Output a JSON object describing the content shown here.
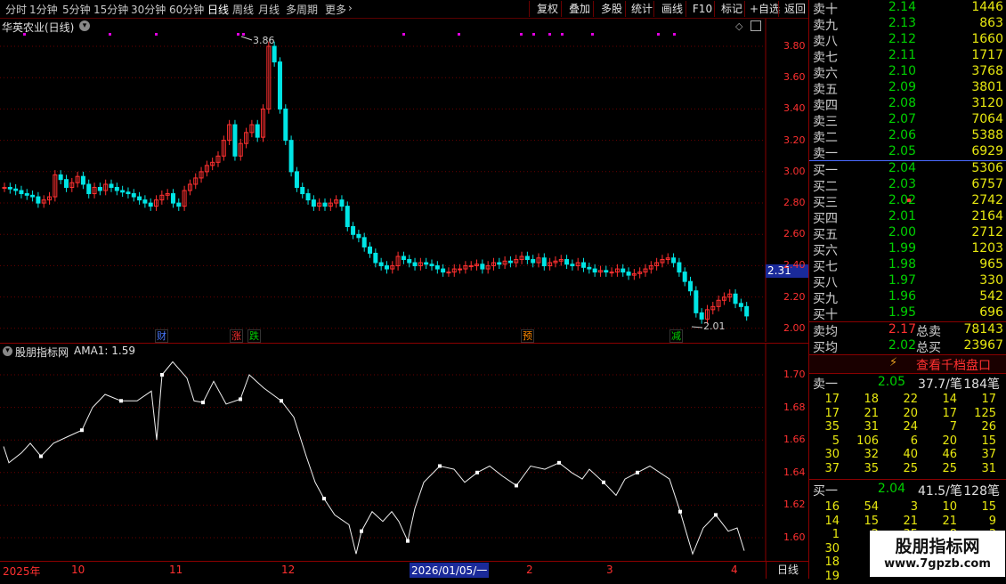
{
  "toolbar": {
    "periods": [
      "分时",
      "1分钟",
      "5分钟",
      "15分钟",
      "30分钟",
      "60分钟",
      "日线",
      "周线",
      "月线",
      "多周期",
      "更多"
    ],
    "more_arrow": "›",
    "buttons": [
      "复权",
      "叠加",
      "多股",
      "统计",
      "画线",
      "F10",
      "标记",
      "+自选",
      "返回"
    ]
  },
  "main": {
    "title": "华英农业(日线)",
    "price_ticks": [
      "3.80",
      "3.60",
      "3.40",
      "3.20",
      "3.00",
      "2.80",
      "2.60",
      "2.40",
      "2.20",
      "2.00"
    ],
    "current_price": "2.31",
    "high_label": "3.86",
    "low_label": "2.01",
    "event_tags": [
      {
        "text": "财",
        "color": "#4a7aff"
      },
      {
        "text": "涨",
        "color": "#ff3030"
      },
      {
        "text": "跌",
        "color": "#00d000"
      },
      {
        "text": "预",
        "color": "#ff8800"
      },
      {
        "text": "减",
        "color": "#00d000"
      }
    ]
  },
  "indicator": {
    "title": "股朋指标网",
    "ama_label": "AMA1: 1.59",
    "ticks": [
      "1.70",
      "1.68",
      "1.66",
      "1.64",
      "1.62",
      "1.60"
    ]
  },
  "date_axis": {
    "labels": [
      "2025年",
      "10",
      "11",
      "12",
      "2026/01/05/一",
      "2",
      "3",
      "4"
    ],
    "period": "日线"
  },
  "orderbook": {
    "asks": [
      {
        "label": "卖十",
        "price": "2.14",
        "vol": "1446"
      },
      {
        "label": "卖九",
        "price": "2.13",
        "vol": "863"
      },
      {
        "label": "卖八",
        "price": "2.12",
        "vol": "1660"
      },
      {
        "label": "卖七",
        "price": "2.11",
        "vol": "1717"
      },
      {
        "label": "卖六",
        "price": "2.10",
        "vol": "3768"
      },
      {
        "label": "卖五",
        "price": "2.09",
        "vol": "3801"
      },
      {
        "label": "卖四",
        "price": "2.08",
        "vol": "3120"
      },
      {
        "label": "卖三",
        "price": "2.07",
        "vol": "7064"
      },
      {
        "label": "卖二",
        "price": "2.06",
        "vol": "5388"
      },
      {
        "label": "卖一",
        "price": "2.05",
        "vol": "6929"
      }
    ],
    "bids": [
      {
        "label": "买一",
        "price": "2.04",
        "vol": "5306"
      },
      {
        "label": "买二",
        "price": "2.03",
        "vol": "6757"
      },
      {
        "label": "买三",
        "price": "2.02",
        "vol": "2742"
      },
      {
        "label": "买四",
        "price": "2.01",
        "vol": "2164"
      },
      {
        "label": "买五",
        "price": "2.00",
        "vol": "2712"
      },
      {
        "label": "买六",
        "price": "1.99",
        "vol": "1203"
      },
      {
        "label": "买七",
        "price": "1.98",
        "vol": "965"
      },
      {
        "label": "买八",
        "price": "1.97",
        "vol": "330"
      },
      {
        "label": "买九",
        "price": "1.96",
        "vol": "542"
      },
      {
        "label": "买十",
        "price": "1.95",
        "vol": "696"
      }
    ],
    "avg_sell_label": "卖均",
    "avg_sell_price": "2.17",
    "total_sell_label": "总卖",
    "total_sell": "78143",
    "avg_buy_label": "买均",
    "avg_buy_price": "2.02",
    "total_buy_label": "总买",
    "total_buy": "23967",
    "view_depth": "查看千档盘口"
  },
  "queue": {
    "sell_label": "卖一",
    "sell_price": "2.05",
    "sell_per": "37.7/笔",
    "sell_count": "184笔",
    "sell_rows": [
      [
        "17",
        "18",
        "22",
        "14",
        "17"
      ],
      [
        "17",
        "21",
        "20",
        "17",
        "125"
      ],
      [
        "35",
        "31",
        "24",
        "7",
        "26"
      ],
      [
        "5",
        "106",
        "6",
        "20",
        "15"
      ],
      [
        "30",
        "32",
        "40",
        "46",
        "37"
      ],
      [
        "37",
        "35",
        "25",
        "25",
        "31"
      ]
    ],
    "buy_label": "买一",
    "buy_price": "2.04",
    "buy_per": "41.5/笔",
    "buy_count": "128笔",
    "buy_rows": [
      [
        "16",
        "54",
        "3",
        "10",
        "15"
      ],
      [
        "14",
        "15",
        "21",
        "21",
        "9"
      ],
      [
        "1",
        "2",
        "35",
        "8",
        "3"
      ],
      [
        "30",
        "2",
        "",
        "",
        ""
      ],
      [
        "18",
        "",
        "",
        "",
        ""
      ],
      [
        "19",
        "",
        "",
        "",
        ""
      ]
    ]
  },
  "watermark": {
    "name": "股朋指标网",
    "url": "www.7gpzb.com"
  },
  "colors": {
    "up": "#ff3030",
    "down": "#00e5e5",
    "grid": "#6a0000",
    "ask_price": "#00d000",
    "volume": "#e8e810",
    "signal_dot": "#e000e0"
  }
}
